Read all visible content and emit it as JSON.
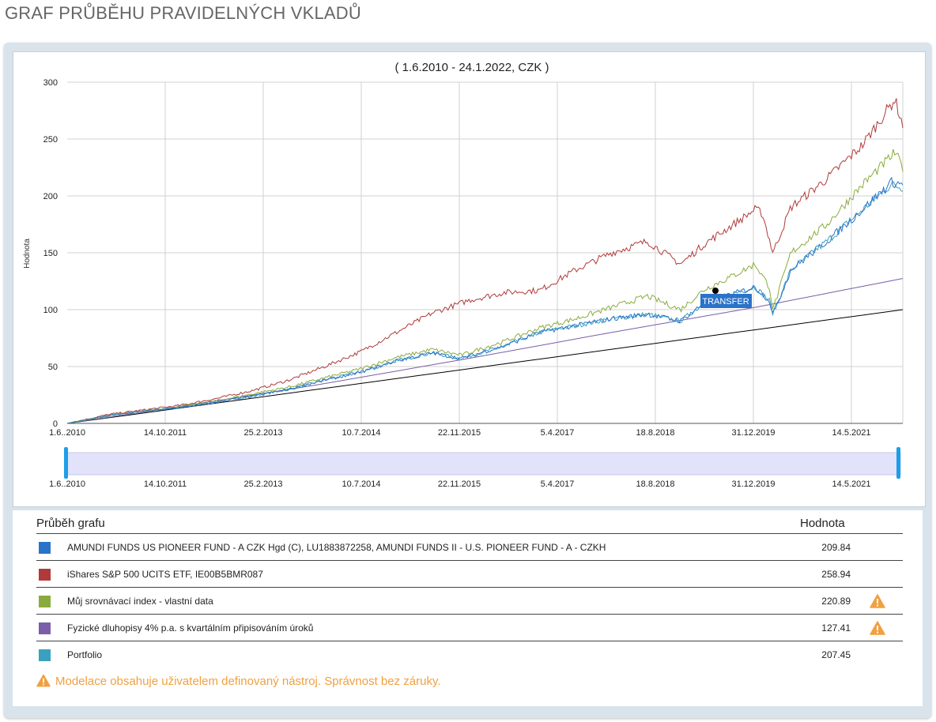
{
  "page_title": "GRAF PRŮBĚHU PRAVIDELNÝCH VKLADŮ",
  "chart_data": {
    "type": "line",
    "title": "( 1.6.2010 - 24.1.2022, CZK )",
    "ylabel": "Hodnota",
    "xlabel": "",
    "ylim": [
      0,
      300
    ],
    "yticks": [
      "0",
      "50",
      "100",
      "150",
      "200",
      "250",
      "300"
    ],
    "x_tick_labels": [
      "1.6..2010",
      "14.10.2011",
      "25.2.2013",
      "10.7.2014",
      "22.11.2015",
      "5.4.2017",
      "18.8.2018",
      "31.12.2019",
      "14.5.2021"
    ],
    "x_range_years": [
      2010.41,
      2022.06
    ],
    "grid": true,
    "annotation": "TRANSFER",
    "navigator_tick_labels": [
      "1.6..2010",
      "14.10.2011",
      "25.2.2013",
      "10.7.2014",
      "22.11.2015",
      "5.4.2017",
      "18.8.2018",
      "31.12.2019",
      "14.5.2021"
    ],
    "series": [
      {
        "name": "AMUNDI FUNDS US PIONEER FUND - A CZK Hgd (C), LU1883872258, AMUNDI FUNDS II - U.S. PIONEER FUND - A - CZKH",
        "color": "#2a73c9",
        "x": [
          2010.41,
          2011.0,
          2011.5,
          2012.0,
          2012.5,
          2013.0,
          2013.5,
          2014.0,
          2014.5,
          2015.0,
          2015.5,
          2015.9,
          2016.5,
          2017.0,
          2017.5,
          2018.0,
          2018.5,
          2018.96,
          2019.3,
          2019.7,
          2020.0,
          2020.2,
          2020.25,
          2020.5,
          2021.0,
          2021.5,
          2021.9,
          2022.06
        ],
        "y": [
          0,
          7,
          11,
          14,
          19,
          24,
          30,
          38,
          45,
          55,
          62,
          57,
          68,
          80,
          86,
          92,
          96,
          90,
          106,
          114,
          120,
          108,
          96,
          135,
          160,
          188,
          212,
          210
        ]
      },
      {
        "name": "iShares S&P 500 UCITS ETF, IE00B5BMR087",
        "color": "#b03a3a",
        "x": [
          2010.41,
          2011.0,
          2011.5,
          2012.0,
          2012.5,
          2013.0,
          2013.5,
          2014.0,
          2014.5,
          2015.0,
          2015.5,
          2016.0,
          2016.5,
          2017.0,
          2017.5,
          2018.0,
          2018.5,
          2018.96,
          2019.3,
          2019.7,
          2020.0,
          2020.1,
          2020.25,
          2020.5,
          2021.0,
          2021.5,
          2021.95,
          2022.06
        ],
        "y": [
          0,
          8,
          12,
          16,
          22,
          29,
          38,
          50,
          63,
          80,
          97,
          108,
          115,
          117,
          135,
          150,
          160,
          140,
          158,
          175,
          188,
          185,
          150,
          190,
          215,
          245,
          285,
          262
        ]
      },
      {
        "name": "Můj srovnávací index - vlastní data",
        "color": "#8aab3c",
        "x": [
          2010.41,
          2011.0,
          2011.5,
          2012.0,
          2012.5,
          2013.0,
          2013.5,
          2014.0,
          2014.5,
          2015.0,
          2015.5,
          2015.9,
          2016.5,
          2017.0,
          2017.5,
          2018.0,
          2018.5,
          2018.96,
          2019.3,
          2019.7,
          2020.0,
          2020.2,
          2020.25,
          2020.5,
          2021.0,
          2021.5,
          2021.95,
          2022.06
        ],
        "y": [
          0,
          7,
          11,
          15,
          20,
          26,
          32,
          40,
          48,
          58,
          65,
          60,
          72,
          84,
          92,
          102,
          112,
          100,
          118,
          130,
          140,
          120,
          100,
          150,
          175,
          210,
          238,
          225
        ]
      },
      {
        "name": "Fyzické dluhopisy 4% p.a. s kvartálním připisováním úroků",
        "color": "#7a5ea8",
        "x": [
          2010.41,
          2012.0,
          2014.0,
          2016.0,
          2018.0,
          2020.0,
          2022.06
        ],
        "y": [
          0,
          15,
          35,
          57,
          80,
          102,
          127.41
        ]
      },
      {
        "name": "Portfolio",
        "color": "#3aa0c0",
        "x": [
          2010.41,
          2011.0,
          2011.5,
          2012.0,
          2012.5,
          2013.0,
          2013.5,
          2014.0,
          2014.5,
          2015.0,
          2015.5,
          2015.9,
          2016.5,
          2017.0,
          2017.5,
          2018.0,
          2018.5,
          2018.96,
          2019.3,
          2019.7,
          2020.0,
          2020.2,
          2020.25,
          2020.5,
          2021.0,
          2021.5,
          2021.9,
          2022.06
        ],
        "y": [
          0,
          7,
          11,
          14,
          19,
          24,
          30,
          38,
          45,
          55,
          62,
          57,
          68,
          80,
          86,
          92,
          96,
          90,
          106,
          114,
          120,
          108,
          96,
          135,
          160,
          188,
          210,
          207
        ]
      },
      {
        "name": "",
        "color": "#000000",
        "x": [
          2010.41,
          2022.06
        ],
        "y": [
          0,
          100
        ]
      }
    ]
  },
  "legend": {
    "header_name": "Průběh grafu",
    "header_value": "Hodnota",
    "rows": [
      {
        "name": "AMUNDI FUNDS US PIONEER FUND - A CZK Hgd (C), LU1883872258, AMUNDI FUNDS II - U.S. PIONEER FUND - A - CZKH",
        "value": "209.84",
        "color": "#2a73c9",
        "warning": false
      },
      {
        "name": "iShares S&P 500 UCITS ETF, IE00B5BMR087",
        "value": "258.94",
        "color": "#b03a3a",
        "warning": false
      },
      {
        "name": "Můj srovnávací index - vlastní data",
        "value": "220.89",
        "color": "#8aab3c",
        "warning": true
      },
      {
        "name": "Fyzické dluhopisy 4% p.a. s kvartálním připisováním úroků",
        "value": "127.41",
        "color": "#7a5ea8",
        "warning": true
      },
      {
        "name": "Portfolio",
        "value": "207.45",
        "color": "#3aa0c0",
        "warning": false
      }
    ],
    "warning_icon": "warning-icon"
  },
  "footer_note": "Modelace obsahuje uživatelem definovaný nástroj. Správnost bez záruky."
}
